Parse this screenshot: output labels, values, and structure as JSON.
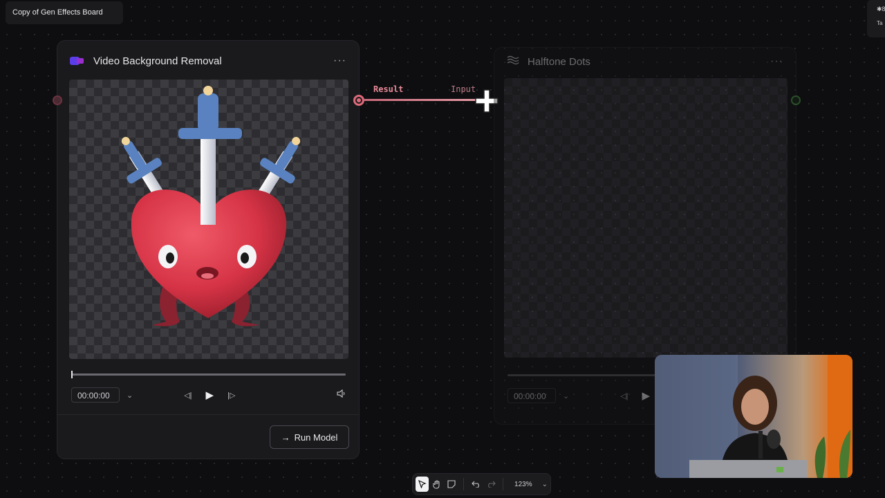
{
  "board": {
    "title": "Copy of Gen Effects Board"
  },
  "corner_chip": {
    "glyph": "✱",
    "label_fragment": "8",
    "sub_fragment": "Ta"
  },
  "nodes": {
    "left": {
      "title": "Video Background Removal",
      "menu_glyph": "···",
      "output_port_label": "Result",
      "timecode": "00:00:00",
      "run_button_label": "Run Model",
      "run_button_arrow": "→"
    },
    "right": {
      "title": "Halftone Dots",
      "menu_glyph": "···",
      "input_port_label": "Input",
      "timecode": "00:00:00"
    }
  },
  "toolbar": {
    "zoom_level": "123%",
    "tools": [
      "select-icon",
      "hand-icon",
      "note-icon",
      "undo-icon",
      "redo-icon"
    ]
  },
  "colors": {
    "accent_connection": "#e06a7a",
    "logo_primary": "#5b3ee8",
    "logo_secondary": "#9a2fd0",
    "right_output_port": "#3b7a3b"
  }
}
